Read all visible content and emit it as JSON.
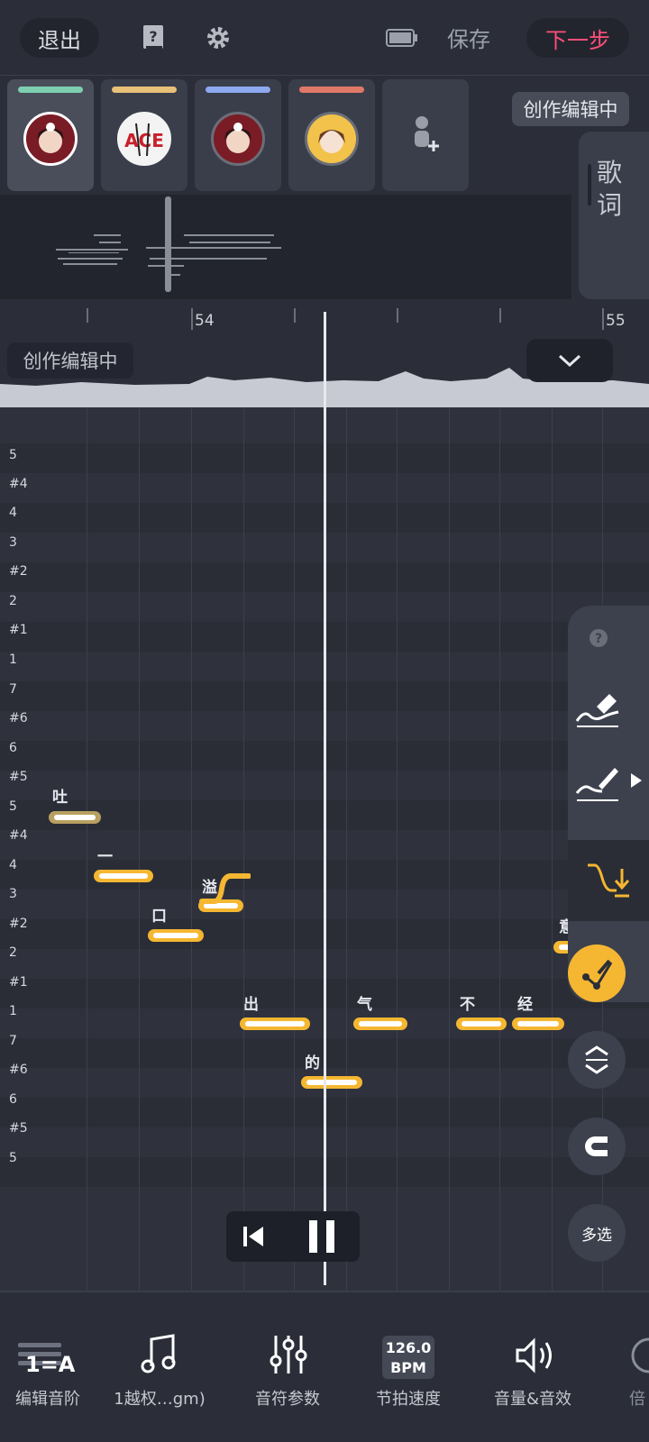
{
  "topbar": {
    "exit_label": "退出",
    "save_label": "保存",
    "next_label": "下一步"
  },
  "singers": [
    {
      "color": "#7ecfb0",
      "avatar": "red-hair-girl"
    },
    {
      "color": "#e8c078",
      "avatar": "ace-logo"
    },
    {
      "color": "#8ea8f0",
      "avatar": "red-hair-girl"
    },
    {
      "color": "#e07868",
      "avatar": "brown-hair-girl"
    }
  ],
  "header": {
    "status_chip": "创作编辑中",
    "lyrics_tab": "歌词"
  },
  "ruler": {
    "labels": [
      "54",
      "55"
    ]
  },
  "timeline": {
    "status_chip": "创作编辑中"
  },
  "pitch_labels": [
    "5",
    "#4",
    "4",
    "3",
    "#2",
    "2",
    "#1",
    "1",
    "7",
    "#6",
    "6",
    "#5",
    "5",
    "#4",
    "4",
    "3",
    "#2",
    "2",
    "#1",
    "1",
    "7",
    "#6",
    "6",
    "#5",
    "5"
  ],
  "notes": [
    {
      "lyric": "吐"
    },
    {
      "lyric": "一"
    },
    {
      "lyric": "口"
    },
    {
      "lyric": "溢"
    },
    {
      "lyric": "出"
    },
    {
      "lyric": "的"
    },
    {
      "lyric": "气"
    },
    {
      "lyric": "不"
    },
    {
      "lyric": "经"
    },
    {
      "lyric": "意"
    }
  ],
  "tools": {
    "multiselect_label": "多选"
  },
  "bottombar": {
    "scale_badge": "1=A",
    "scale_label": "编辑音阶",
    "song_label": "1越权…gm)",
    "params_label": "音符参数",
    "bpm_value": "126.0",
    "bpm_unit": "BPM",
    "tempo_label": "节拍速度",
    "volume_label": "音量&音效",
    "speed_label": "倍"
  },
  "colors": {
    "accent_pink": "#ff4f7a",
    "note_yellow": "#f5b731"
  }
}
